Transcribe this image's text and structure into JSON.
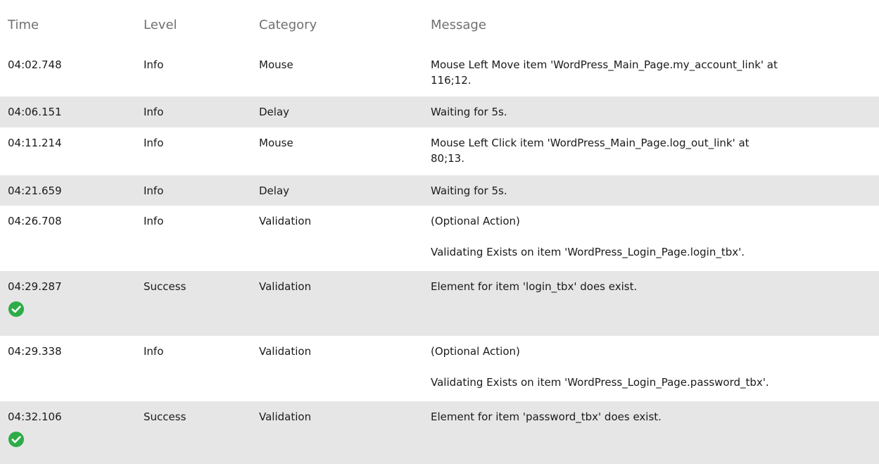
{
  "columns": {
    "time": "Time",
    "level": "Level",
    "category": "Category",
    "message": "Message"
  },
  "colors": {
    "success": "#2dac47",
    "row_shade": "#e6e6e6",
    "header_text": "#707070"
  },
  "rows": [
    {
      "time": "04:02.748",
      "level": "Info",
      "category": "Mouse",
      "message_lines": [
        "Mouse Left Move item 'WordPress_Main_Page.my_account_link' at",
        "116;12."
      ]
    },
    {
      "time": "04:06.151",
      "level": "Info",
      "category": "Delay",
      "message_lines": [
        "Waiting for 5s."
      ]
    },
    {
      "time": "04:11.214",
      "level": "Info",
      "category": "Mouse",
      "message_lines": [
        "Mouse Left Click item 'WordPress_Main_Page.log_out_link' at",
        "80;13."
      ]
    },
    {
      "time": "04:21.659",
      "level": "Info",
      "category": "Delay",
      "message_lines": [
        "Waiting for 5s."
      ]
    },
    {
      "time": "04:26.708",
      "level": "Info",
      "category": "Validation",
      "message_lines": [
        "(Optional Action)",
        "",
        "Validating Exists on item 'WordPress_Login_Page.login_tbx'."
      ]
    },
    {
      "time": "04:29.287",
      "level": "Success",
      "category": "Validation",
      "icon": "check-circle-icon",
      "message_lines": [
        "Element for item 'login_tbx' does exist."
      ]
    },
    {
      "time": "04:29.338",
      "level": "Info",
      "category": "Validation",
      "message_lines": [
        "(Optional Action)",
        "",
        "Validating Exists on item 'WordPress_Login_Page.password_tbx'."
      ]
    },
    {
      "time": "04:32.106",
      "level": "Success",
      "category": "Validation",
      "icon": "check-circle-icon",
      "message_lines": [
        "Element for item 'password_tbx' does exist."
      ]
    }
  ]
}
